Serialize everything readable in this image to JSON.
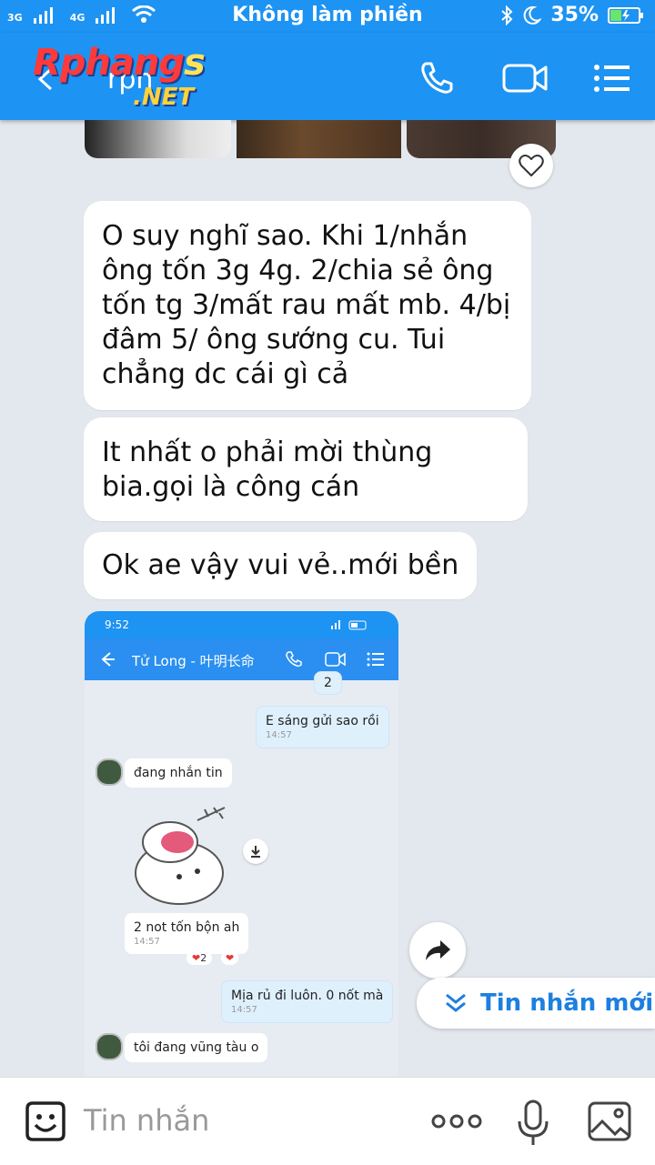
{
  "status_bar": {
    "network_1": "3G",
    "network_2": "4G",
    "title": "Không làm phiền",
    "battery": "35%"
  },
  "header": {
    "logo_main_prefix": "Rphang",
    "logo_main_suffix": "s",
    "logo_sub": ".NET",
    "contact_partial": "rpn",
    "icons": [
      "back-icon",
      "phone-icon",
      "video-icon",
      "menu-icon"
    ]
  },
  "messages": [
    {
      "text": "O suy nghĩ sao. Khi 1/nhắn ông tốn 3g 4g. 2/chia sẻ ông tốn tg 3/mất rau mất mb. 4/bị đâm 5/ ông sướng cu. Tui chẳng dc cái gì cả"
    },
    {
      "text": "It nhất o phải mời thùng bia.gọi là công cán"
    },
    {
      "text": "Ok ae vậy vui vẻ..mới bền"
    }
  ],
  "screenshot": {
    "time": "9:52",
    "contact_name": "Tử Long - 叶明长命",
    "partial_value": "2",
    "msg_out_1": "E sáng gửi sao rồi",
    "msg_out_1_time": "14:57",
    "msg_in_1": "đang nhắn tin",
    "msg_in_2": "2 not tốn bộn ah",
    "msg_in_2_time": "14:57",
    "reaction_count": "2",
    "msg_out_2": "Mịa rủ đi luôn. 0 nốt mà",
    "msg_out_2_time": "14:57",
    "msg_in_3": "tôi đang vũng tàu o"
  },
  "new_messages_button": "Tin nhắn mới",
  "input": {
    "placeholder": "Tin nhắn"
  },
  "colors": {
    "header_blue": "#1d93f3",
    "accent_blue": "#1d7fe0",
    "background": "#e3e8ee"
  }
}
